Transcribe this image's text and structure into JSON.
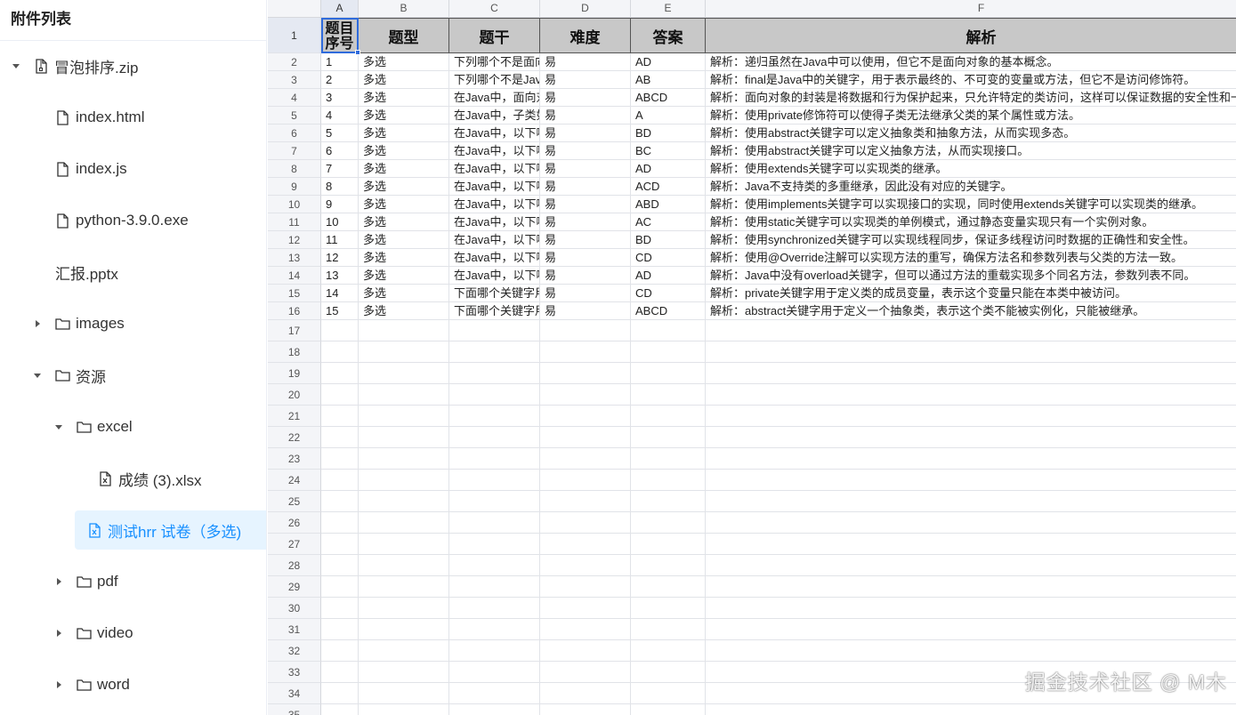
{
  "sidebar": {
    "title": "附件列表",
    "nodes": [
      {
        "label": "冒泡排序.zip",
        "level": 0,
        "caret": "down",
        "icon": "zip-file-icon",
        "selected": false
      },
      {
        "label": "index.html",
        "level": 1,
        "caret": "none",
        "icon": "file-icon",
        "selected": false
      },
      {
        "label": "index.js",
        "level": 1,
        "caret": "none",
        "icon": "file-icon",
        "selected": false
      },
      {
        "label": "python-3.9.0.exe",
        "level": 1,
        "caret": "none",
        "icon": "file-icon",
        "selected": false
      },
      {
        "label": "汇报.pptx",
        "level": 1,
        "caret": "none",
        "icon": "none",
        "selected": false
      },
      {
        "label": "images",
        "level": 1,
        "caret": "right",
        "icon": "folder-icon",
        "selected": false
      },
      {
        "label": "资源",
        "level": 1,
        "caret": "down",
        "icon": "folder-icon",
        "selected": false
      },
      {
        "label": "excel",
        "level": 2,
        "caret": "down",
        "icon": "folder-icon",
        "selected": false
      },
      {
        "label": "成绩 (3).xlsx",
        "level": 3,
        "caret": "none",
        "icon": "excel-file-icon",
        "selected": false
      },
      {
        "label": "测试hrr 试卷（多选)",
        "level": 3,
        "caret": "none",
        "icon": "excel-file-icon",
        "selected": true
      },
      {
        "label": "pdf",
        "level": 2,
        "caret": "right",
        "icon": "folder-icon",
        "selected": false
      },
      {
        "label": "video",
        "level": 2,
        "caret": "right",
        "icon": "folder-icon",
        "selected": false
      },
      {
        "label": "word",
        "level": 2,
        "caret": "right",
        "icon": "folder-icon",
        "selected": false
      }
    ]
  },
  "sheet": {
    "columns": [
      "A",
      "B",
      "C",
      "D",
      "E",
      "F"
    ],
    "header_row": [
      "题目序号",
      "题型",
      "题干",
      "难度",
      "答案",
      "解析"
    ],
    "rows": [
      [
        "1",
        "多选",
        "下列哪个不是面向对象的基本概念？",
        "易",
        "AD",
        "解析：递归虽然在Java中可以使用，但它不是面向对象的基本概念。"
      ],
      [
        "2",
        "多选",
        "下列哪个不是Java中的关键字？",
        "易",
        "AB",
        "解析：final是Java中的关键字，用于表示最终的、不可变的变量或方法，但它不是访问修饰符。"
      ],
      [
        "3",
        "多选",
        "在Java中，面向对象的封装是指？",
        "易",
        "ABCD",
        "解析：面向对象的封装是将数据和行为保护起来，只允许特定的类访问，这样可以保证数据的安全性和一致性。"
      ],
      [
        "4",
        "多选",
        "在Java中，子类如何无法继承父类的某个属性或方法？",
        "易",
        "A",
        "解析：使用private修饰符可以使得子类无法继承父类的某个属性或方法。"
      ],
      [
        "5",
        "多选",
        "在Java中，以下哪些关键字可以实现多态？",
        "易",
        "BD",
        "解析：使用abstract关键字可以定义抽象类和抽象方法，从而实现多态。"
      ],
      [
        "6",
        "多选",
        "在Java中，以下哪些关键字可以实现接口？",
        "易",
        "BC",
        "解析：使用abstract关键字可以定义抽象方法，从而实现接口。"
      ],
      [
        "7",
        "多选",
        "在Java中，以下哪些关键字可以实现类的继承？",
        "易",
        "AD",
        "解析：使用extends关键字可以实现类的继承。"
      ],
      [
        "8",
        "多选",
        "在Java中，以下哪些关键字可以实现多重继承？",
        "易",
        "ACD",
        "解析：Java不支持类的多重继承，因此没有对应的关键字。"
      ],
      [
        "9",
        "多选",
        "在Java中，以下哪些关键字可以实现接口的实现？",
        "易",
        "ABD",
        "解析：使用implements关键字可以实现接口的实现，同时使用extends关键字可以实现类的继承。"
      ],
      [
        "10",
        "多选",
        "在Java中，以下哪些关键字可以实现单例模式？",
        "易",
        "AC",
        "解析：使用static关键字可以实现类的单例模式，通过静态变量实现只有一个实例对象。"
      ],
      [
        "11",
        "多选",
        "在Java中，以下哪些关键字可以实现线程同步？",
        "易",
        "BD",
        "解析：使用synchronized关键字可以实现线程同步，保证多线程访问时数据的正确性和安全性。"
      ],
      [
        "12",
        "多选",
        "在Java中，以下哪些注解可以实现方法的重写？",
        "易",
        "CD",
        "解析：使用@Override注解可以实现方法的重写，确保方法名和参数列表与父类的方法一致。"
      ],
      [
        "13",
        "多选",
        "在Java中，以下哪些关键字可以实现方法的重载？",
        "易",
        "AD",
        "解析：Java中没有overload关键字，但可以通过方法的重载实现多个同名方法，参数列表不同。"
      ],
      [
        "14",
        "多选",
        "下面哪个关键字用于定义类的成员变量？",
        "易",
        "CD",
        "解析：private关键字用于定义类的成员变量，表示这个变量只能在本类中被访问。"
      ],
      [
        "15",
        "多选",
        "下面哪个关键字用于定义抽象类？",
        "易",
        "ABCD",
        "解析：abstract关键字用于定义一个抽象类，表示这个类不能被实例化，只能被继承。"
      ]
    ],
    "row_numbers": [
      "1",
      "2",
      "3",
      "4",
      "5",
      "6",
      "7",
      "8",
      "9",
      "10",
      "11",
      "12",
      "13",
      "14",
      "15",
      "16",
      "17",
      "18",
      "19",
      "20",
      "21",
      "22",
      "23",
      "24",
      "25",
      "26",
      "27",
      "28",
      "29",
      "30",
      "31",
      "32",
      "33",
      "34",
      "35"
    ]
  },
  "watermark": "掘金技术社区 @ M木",
  "colors": {
    "selected_bg": "#e6f4ff",
    "selected_text": "#1890ff",
    "header_fill": "#c8c8c8",
    "selection_border": "#2f6bdc"
  }
}
